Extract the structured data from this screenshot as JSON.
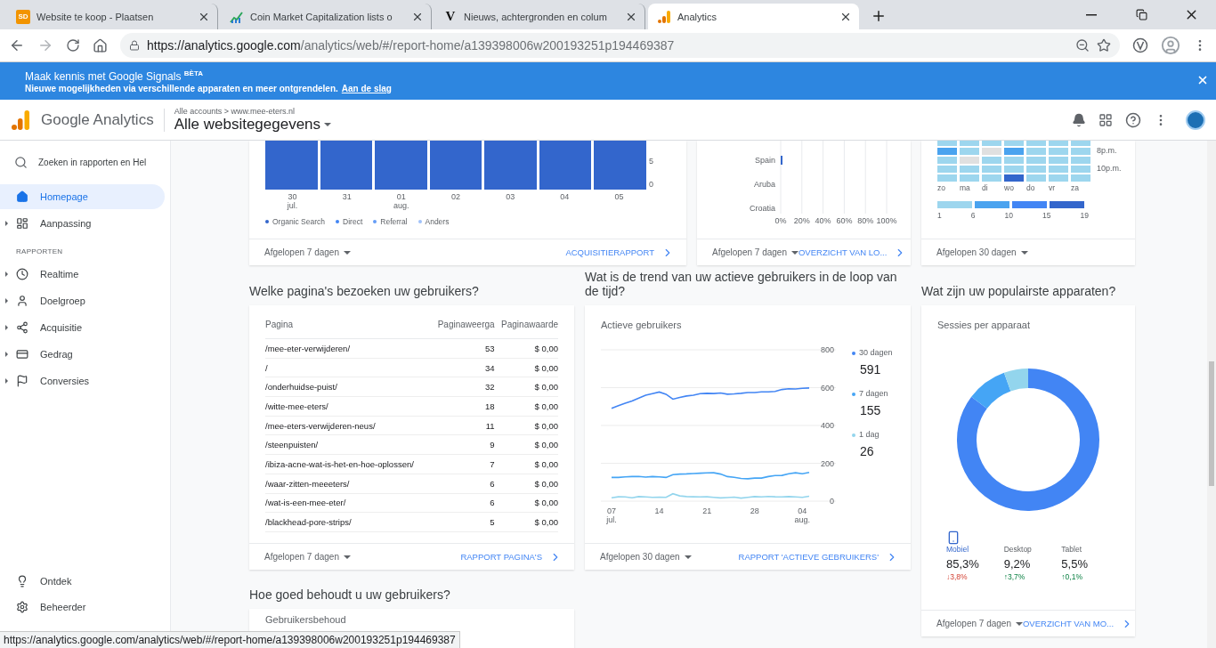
{
  "browser": {
    "tabs": [
      {
        "kind": "text",
        "favicon_text": "SD",
        "title": "Website te koop - Plaatsen",
        "selected": false
      },
      {
        "kind": "chart",
        "title": "Coin Market Capitalization lists o",
        "selected": false
      },
      {
        "kind": "text",
        "favicon_text": "V",
        "title": "Nieuws, achtergronden en colum",
        "selected": false
      },
      {
        "kind": "analytics",
        "title": "Analytics",
        "selected": true
      }
    ],
    "url_host": "https://analytics.google.com",
    "url_path": "/analytics/web/#/report-home/a139398006w200193251p194469387"
  },
  "banner": {
    "title": "Maak kennis met Google Signals $^{BÈTA}$",
    "text": "Nieuwe mogelijkheden via verschillende apparaten en meer ontgrendelen.",
    "link": "Aan de slag"
  },
  "header": {
    "product": "Google Analytics",
    "breadcrumb": "Alle accounts > www.mee-eters.nl",
    "view": "Alle websitegegevens"
  },
  "sidebar": {
    "search": {
      "placeholder": "Zoeken in rapporten en Hel"
    },
    "items": [
      {
        "label": "Homepage",
        "selected": true,
        "expandable": false
      },
      {
        "label": "Aanpassing",
        "selected": false,
        "expandable": true
      }
    ],
    "section": "RAPPORTEN",
    "reports": [
      {
        "label": "Realtime",
        "selected": false,
        "expandable": true
      },
      {
        "label": "Doelgroep",
        "selected": false,
        "expandable": true
      },
      {
        "label": "Acquisitie",
        "selected": false,
        "expandable": true
      },
      {
        "label": "Gedrag",
        "selected": false,
        "expandable": true
      },
      {
        "label": "Conversies",
        "selected": false,
        "expandable": true
      }
    ],
    "bottom": [
      {
        "label": "Ontdek",
        "selected": false
      },
      {
        "label": "Beheerder",
        "selected": false
      }
    ]
  },
  "acquisition": {
    "y_ticks": [
      "5",
      "0"
    ],
    "x_labels": [
      {
        "day": "30",
        "month": "jul."
      },
      {
        "day": "31"
      },
      {
        "day": "01",
        "month": "aug."
      },
      {
        "day": "02"
      },
      {
        "day": "03"
      },
      {
        "day": "04"
      },
      {
        "day": "05"
      }
    ],
    "legend": [
      {
        "label": "Organic Search",
        "color": "#3366cc"
      },
      {
        "label": "Direct",
        "color": "#4285f4"
      },
      {
        "label": "Referral",
        "color": "#669df6"
      },
      {
        "label": "Anders",
        "color": "#a1c2fa"
      }
    ],
    "footer": {
      "period": "Afgelopen 7 dagen",
      "link": "ACQUISITIERAPPORT"
    }
  },
  "countries": {
    "chart_data": {
      "type": "bar",
      "orientation": "horizontal",
      "categories": [
        "Spain",
        "Aruba",
        "Croatia"
      ],
      "values": [
        1,
        0,
        0
      ],
      "xlim": [
        0,
        100
      ],
      "grid": true,
      "xticks": [
        {
          "value": 0,
          "label": "0%"
        },
        {
          "value": 20,
          "label": "20%"
        },
        {
          "value": 40,
          "label": "40%"
        },
        {
          "value": 60,
          "label": "60%"
        },
        {
          "value": 80,
          "label": "80%"
        },
        {
          "value": 100,
          "label": "100%"
        }
      ]
    },
    "footer": {
      "period": "Afgelopen 7 dagen",
      "link": "OVERZICHT VAN LO..."
    }
  },
  "heatmap": {
    "hour_labels": [
      "8p.m.",
      "10p.m."
    ],
    "days": [
      "zo",
      "ma",
      "di",
      "wo",
      "do",
      "vr",
      "za"
    ],
    "legend": [
      "1",
      "6",
      "10",
      "15",
      "19"
    ],
    "footer": {
      "period": "Afgelopen 30 dagen"
    }
  },
  "pages": {
    "heading": "Welke pagina's bezoeken uw gebruikers?",
    "columns": [
      "Pagina",
      "Paginaweerga",
      "Paginawaarde"
    ],
    "rows": [
      [
        "/mee-eter-verwijderen/",
        "53",
        "$ 0,00"
      ],
      [
        "/",
        "34",
        "$ 0,00"
      ],
      [
        "/onderhuidse-puist/",
        "32",
        "$ 0,00"
      ],
      [
        "/witte-mee-eters/",
        "18",
        "$ 0,00"
      ],
      [
        "/mee-eters-verwijderen-neus/",
        "11",
        "$ 0,00"
      ],
      [
        "/steenpuisten/",
        "9",
        "$ 0,00"
      ],
      [
        "/ibiza-acne-wat-is-het-en-hoe-oplossen/",
        "7",
        "$ 0,00"
      ],
      [
        "/waar-zitten-meeeters/",
        "6",
        "$ 0,00"
      ],
      [
        "/wat-is-een-mee-eter/",
        "6",
        "$ 0,00"
      ],
      [
        "/blackhead-pore-strips/",
        "5",
        "$ 0,00"
      ]
    ],
    "footer": {
      "period": "Afgelopen 7 dagen",
      "link": "RAPPORT PAGINA'S"
    }
  },
  "active_users": {
    "heading": "Wat is de trend van uw actieve gebruikers in de loop van de tijd?",
    "title": "Actieve gebruikers",
    "chart_data": {
      "type": "line",
      "categories": [
        "07 jul.",
        null,
        null,
        null,
        null,
        null,
        null,
        "14",
        null,
        null,
        null,
        null,
        null,
        null,
        "21",
        null,
        null,
        null,
        null,
        null,
        null,
        "28",
        null,
        null,
        null,
        null,
        null,
        null,
        "04 aug.",
        null
      ],
      "series": [
        {
          "name": "30 dagen",
          "color": "#4285f4",
          "values": [
            491,
            505,
            518,
            530,
            545,
            560,
            568,
            577,
            565,
            539,
            548,
            556,
            560,
            568,
            570,
            569,
            572,
            565,
            567,
            570,
            574,
            574,
            578,
            578,
            580,
            590,
            594,
            593,
            596,
            598
          ]
        },
        {
          "name": "7 dagen",
          "color": "#45a5f5",
          "values": [
            125,
            125,
            128,
            130,
            131,
            127,
            130,
            128,
            125,
            140,
            143,
            144,
            146,
            148,
            149,
            150,
            143,
            130,
            126,
            120,
            118,
            122,
            122,
            130,
            135,
            136,
            145,
            150,
            145,
            152
          ]
        },
        {
          "name": "1 dag",
          "color": "#93d5ed",
          "values": [
            18,
            23,
            22,
            18,
            24,
            22,
            20,
            21,
            20,
            39,
            28,
            24,
            23,
            22,
            23,
            20,
            17,
            19,
            21,
            16,
            20,
            24,
            22,
            25,
            23,
            22,
            24,
            22,
            20,
            26
          ]
        }
      ],
      "ylim": [
        0,
        800
      ],
      "yticks": [
        0,
        200,
        400,
        600,
        800
      ],
      "grid": true
    },
    "legend_values": [
      "591",
      "155",
      "26"
    ],
    "footer": {
      "period": "Afgelopen 30 dagen",
      "link": "RAPPORT 'ACTIEVE GEBRUIKERS'"
    }
  },
  "devices": {
    "heading": "Wat zijn uw populairste apparaten?",
    "title": "Sessies per apparaat",
    "chart_data": {
      "type": "donut",
      "categories": [
        "Mobiel",
        "Desktop",
        "Tablet"
      ],
      "values": [
        85.3,
        9.2,
        5.5
      ],
      "colors": [
        "#4285f4",
        "#45a5f5",
        "#93d5ed"
      ]
    },
    "items": [
      {
        "value": "85,3%",
        "change": "↓3,8%",
        "rising": false,
        "selected": true
      },
      {
        "value": "9,2%",
        "change": "↑3,7%",
        "rising": true,
        "selected": false
      },
      {
        "value": "5,5%",
        "change": "↑0,1%",
        "rising": true,
        "selected": false
      }
    ],
    "footer": {
      "period": "Afgelopen 7 dagen",
      "link": "OVERZICHT VAN MO..."
    }
  },
  "retention": {
    "heading": "Hoe goed behoudt u uw gebruikers?",
    "title": "Gebruikersbehoud"
  },
  "status_url": "https://analytics.google.com/analytics/web/#/report-home/a139398006w200193251p194469387"
}
